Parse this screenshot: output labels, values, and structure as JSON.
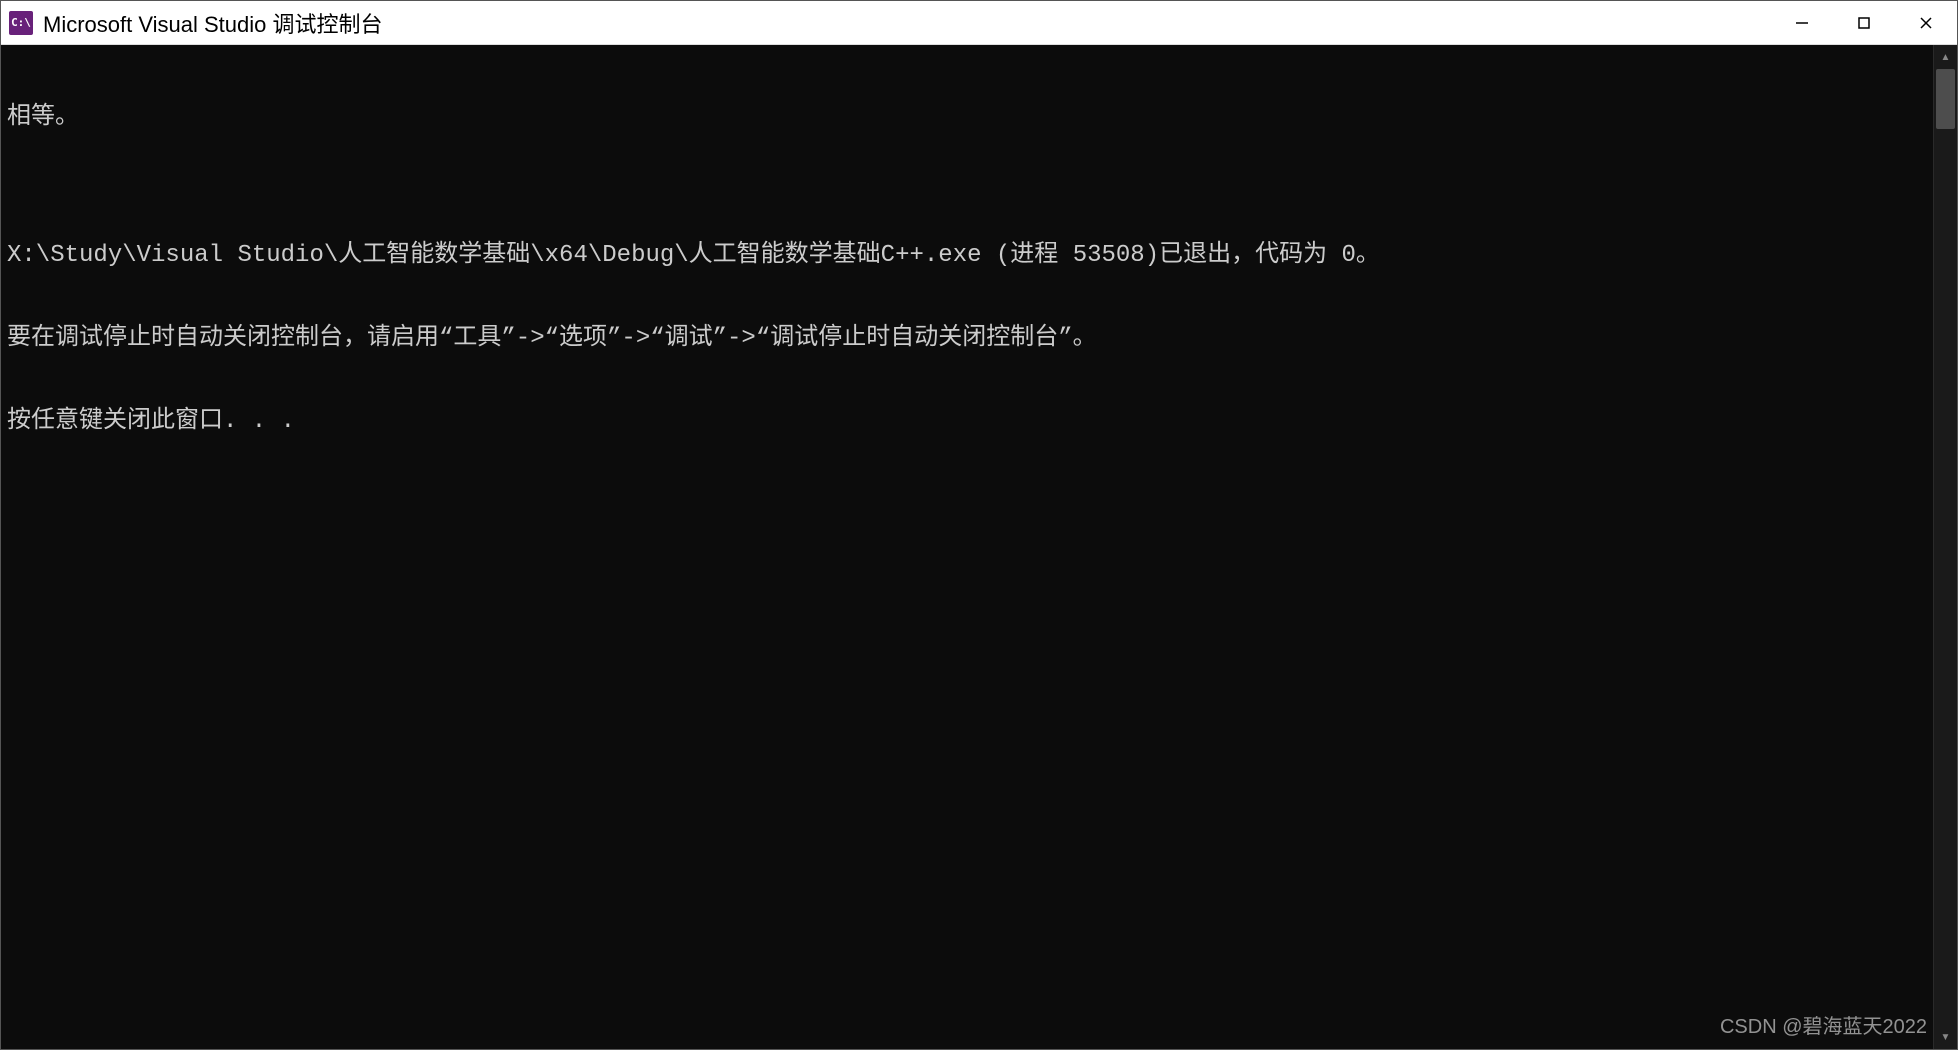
{
  "window": {
    "app_icon_text": "C:\\",
    "title": "Microsoft Visual Studio 调试控制台"
  },
  "console": {
    "lines": [
      "相等。",
      "",
      "X:\\Study\\Visual Studio\\人工智能数学基础\\x64\\Debug\\人工智能数学基础C++.exe (进程 53508)已退出，代码为 0。",
      "要在调试停止时自动关闭控制台，请启用“工具”->“选项”->“调试”->“调试停止时自动关闭控制台”。",
      "按任意键关闭此窗口. . ."
    ]
  },
  "watermark": "CSDN @碧海蓝天2022"
}
